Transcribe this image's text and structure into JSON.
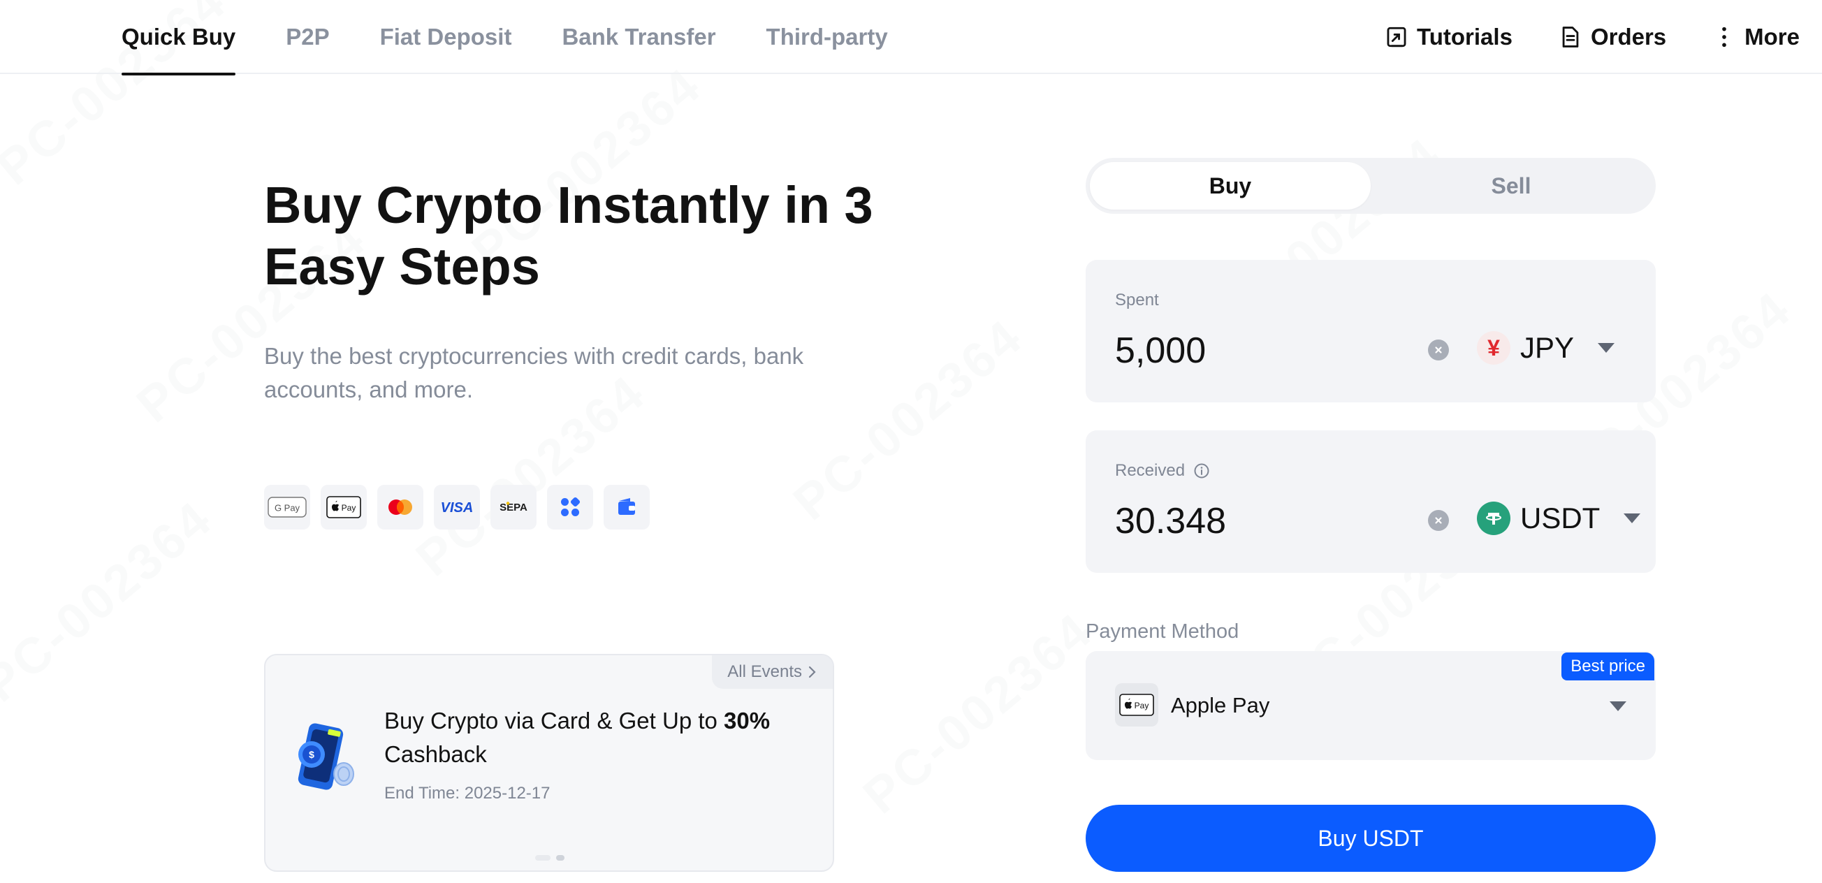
{
  "nav": {
    "tabs": [
      {
        "label": "Quick Buy",
        "active": true
      },
      {
        "label": "P2P",
        "active": false
      },
      {
        "label": "Fiat Deposit",
        "active": false
      },
      {
        "label": "Bank Transfer",
        "active": false
      },
      {
        "label": "Third-party",
        "active": false
      }
    ],
    "right": {
      "tutorials": "Tutorials",
      "orders": "Orders",
      "more": "More"
    }
  },
  "hero": {
    "title": "Buy Crypto Instantly in 3 Easy Steps",
    "subtitle": "Buy the best cryptocurrencies with credit cards, bank accounts, and more.",
    "payment_icons": [
      "google-pay-icon",
      "apple-pay-icon",
      "mastercard-icon",
      "visa-icon",
      "sepa-icon",
      "binance-app-icon",
      "wallet-icon"
    ],
    "payment_icon_text": {
      "google_pay": "G Pay",
      "apple_pay": "Pay",
      "visa": "VISA",
      "sepa": "SEPA"
    }
  },
  "event": {
    "all_events": "All Events",
    "title_prefix": "Buy Crypto via Card & Get Up to ",
    "title_highlight": "30%",
    "title_suffix": " Cashback",
    "end_time": "End Time: 2025-12-17",
    "slides": 2,
    "active_slide": 0
  },
  "trade": {
    "buy_label": "Buy",
    "sell_label": "Sell",
    "mode": "Buy",
    "spent": {
      "label": "Spent",
      "value": "5,000",
      "currency": "JPY",
      "currency_symbol": "¥"
    },
    "received": {
      "label": "Received",
      "value": "30.348",
      "currency": "USDT"
    },
    "payment_method": {
      "label": "Payment Method",
      "name": "Apple Pay",
      "badge": "Best price"
    },
    "submit_label": "Buy USDT"
  },
  "colors": {
    "accent": "#0b5cff",
    "usdt": "#26a17b",
    "jpy": "#e0282e",
    "muted": "#858c99",
    "field_bg": "#f3f4f7"
  },
  "watermark": "PC-002364"
}
